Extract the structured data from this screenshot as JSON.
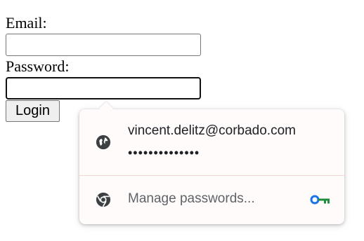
{
  "form": {
    "email_label": "Email:",
    "password_label": "Password:",
    "email_value": "",
    "password_value": "",
    "login_label": "Login"
  },
  "autofill": {
    "suggestion": {
      "username": "vincent.delitz@corbado.com",
      "password_mask": "••••••••••••••",
      "icon": "globe-icon"
    },
    "manage": {
      "label": "Manage passwords...",
      "icon": "chrome-icon",
      "trailing_icon": "key-icon"
    }
  },
  "colors": {
    "key_blue": "#1a73e8",
    "key_green": "#1e8e3e",
    "divider": "#f6d6cf"
  }
}
